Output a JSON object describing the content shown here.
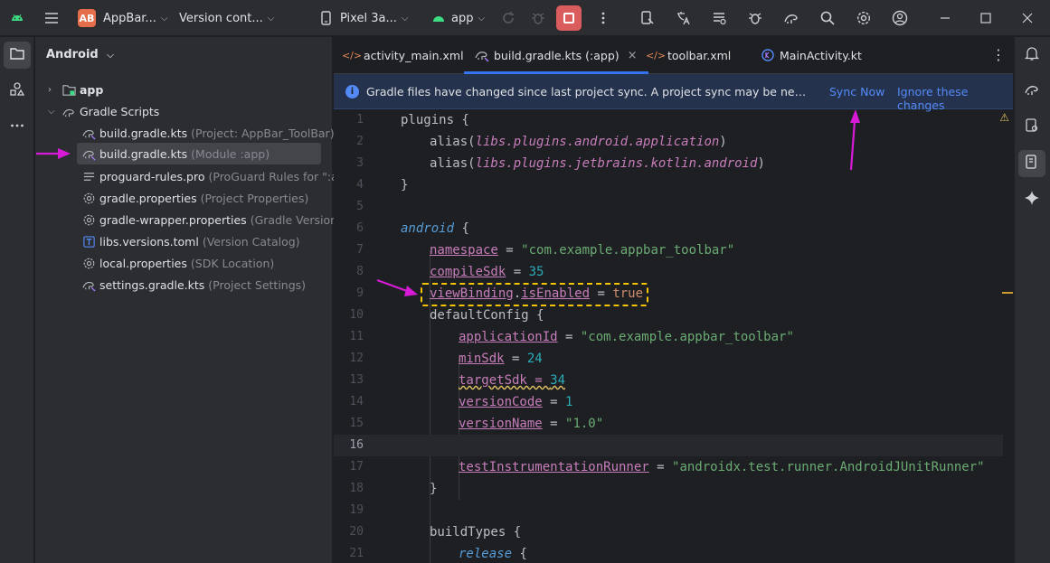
{
  "titlebar": {
    "project_badge": "AB",
    "project_name": "AppBar...",
    "vcs_label": "Version cont...",
    "device": "Pixel 3a...",
    "run_config": "app"
  },
  "project_panel": {
    "view_name": "Android",
    "tree": [
      {
        "label": "app",
        "hint": "",
        "icon": "folder-module-icon"
      },
      {
        "label": "Gradle Scripts",
        "hint": "",
        "icon": "gradle-icon"
      },
      {
        "label": "build.gradle.kts",
        "hint": "(Project: AppBar_ToolBar)",
        "icon": "gradle-kts-icon"
      },
      {
        "label": "build.gradle.kts",
        "hint": "(Module :app)",
        "icon": "gradle-kts-icon"
      },
      {
        "label": "proguard-rules.pro",
        "hint": "(ProGuard Rules for \":app\")",
        "icon": "text-file-icon"
      },
      {
        "label": "gradle.properties",
        "hint": "(Project Properties)",
        "icon": "properties-icon"
      },
      {
        "label": "gradle-wrapper.properties",
        "hint": "(Gradle Version)",
        "icon": "properties-icon"
      },
      {
        "label": "libs.versions.toml",
        "hint": "(Version Catalog)",
        "icon": "toml-icon"
      },
      {
        "label": "local.properties",
        "hint": "(SDK Location)",
        "icon": "properties-icon"
      },
      {
        "label": "settings.gradle.kts",
        "hint": "(Project Settings)",
        "icon": "gradle-kts-icon"
      }
    ]
  },
  "tabs": [
    {
      "label": "activity_main.xml",
      "icon": "xml-icon"
    },
    {
      "label": "build.gradle.kts (:app)",
      "icon": "gradle-kts-icon",
      "close": "×"
    },
    {
      "label": "toolbar.xml",
      "icon": "xml-icon"
    },
    {
      "label": "MainActivity.kt",
      "icon": "kotlin-icon"
    }
  ],
  "banner": {
    "info_glyph": "i",
    "message": "Gradle files have changed since last project sync. A project sync may be necessary for the IDE to work properly.",
    "sync_now": "Sync Now",
    "ignore": "Ignore these changes"
  },
  "code": {
    "line_numbers": [
      "1",
      "2",
      "3",
      "4",
      "5",
      "6",
      "7",
      "8",
      "9",
      "10",
      "11",
      "12",
      "13",
      "14",
      "15",
      "16",
      "17",
      "18",
      "19",
      "20",
      "21"
    ],
    "l1": {
      "a": "plugins {"
    },
    "l2": {
      "a": "alias(",
      "b": "libs.plugins.android.application",
      "c": ")"
    },
    "l3": {
      "a": "alias(",
      "b": "libs.plugins.jetbrains.kotlin.android",
      "c": ")"
    },
    "l4": {
      "a": "}"
    },
    "l6": {
      "a": "android",
      "b": " {"
    },
    "l7": {
      "a": "namespace",
      "b": " = ",
      "c": "\"com.example.appbar_toolbar\""
    },
    "l8": {
      "a": "compileSdk",
      "b": " = ",
      "c": "35"
    },
    "l9": {
      "a": "viewBinding",
      "b": ".",
      "c": "isEnabled",
      "d": " = ",
      "e": "true"
    },
    "l10": {
      "a": "defaultConfig {"
    },
    "l11": {
      "a": "applicationId",
      "b": " = ",
      "c": "\"com.example.appbar_toolbar\""
    },
    "l12": {
      "a": "minSdk",
      "b": " = ",
      "c": "24"
    },
    "l13": {
      "a": "targetSdk = ",
      "b": "34"
    },
    "l14": {
      "a": "versionCode",
      "b": " = ",
      "c": "1"
    },
    "l15": {
      "a": "versionName",
      "b": " = ",
      "c": "\"1.0\""
    },
    "l17": {
      "a": "testInstrumentationRunner",
      "b": " = ",
      "c": "\"androidx.test.runner.AndroidJUnitRunner\""
    },
    "l18": {
      "a": "}"
    },
    "l20": {
      "a": "buildTypes {"
    },
    "l21": {
      "a": "release",
      "b": " {"
    }
  },
  "gutter": {
    "warning_glyph": "⚠"
  },
  "colors": {
    "accent": "#3574f0",
    "annotation": "#d61ad6",
    "highlight": "#f5c400"
  }
}
